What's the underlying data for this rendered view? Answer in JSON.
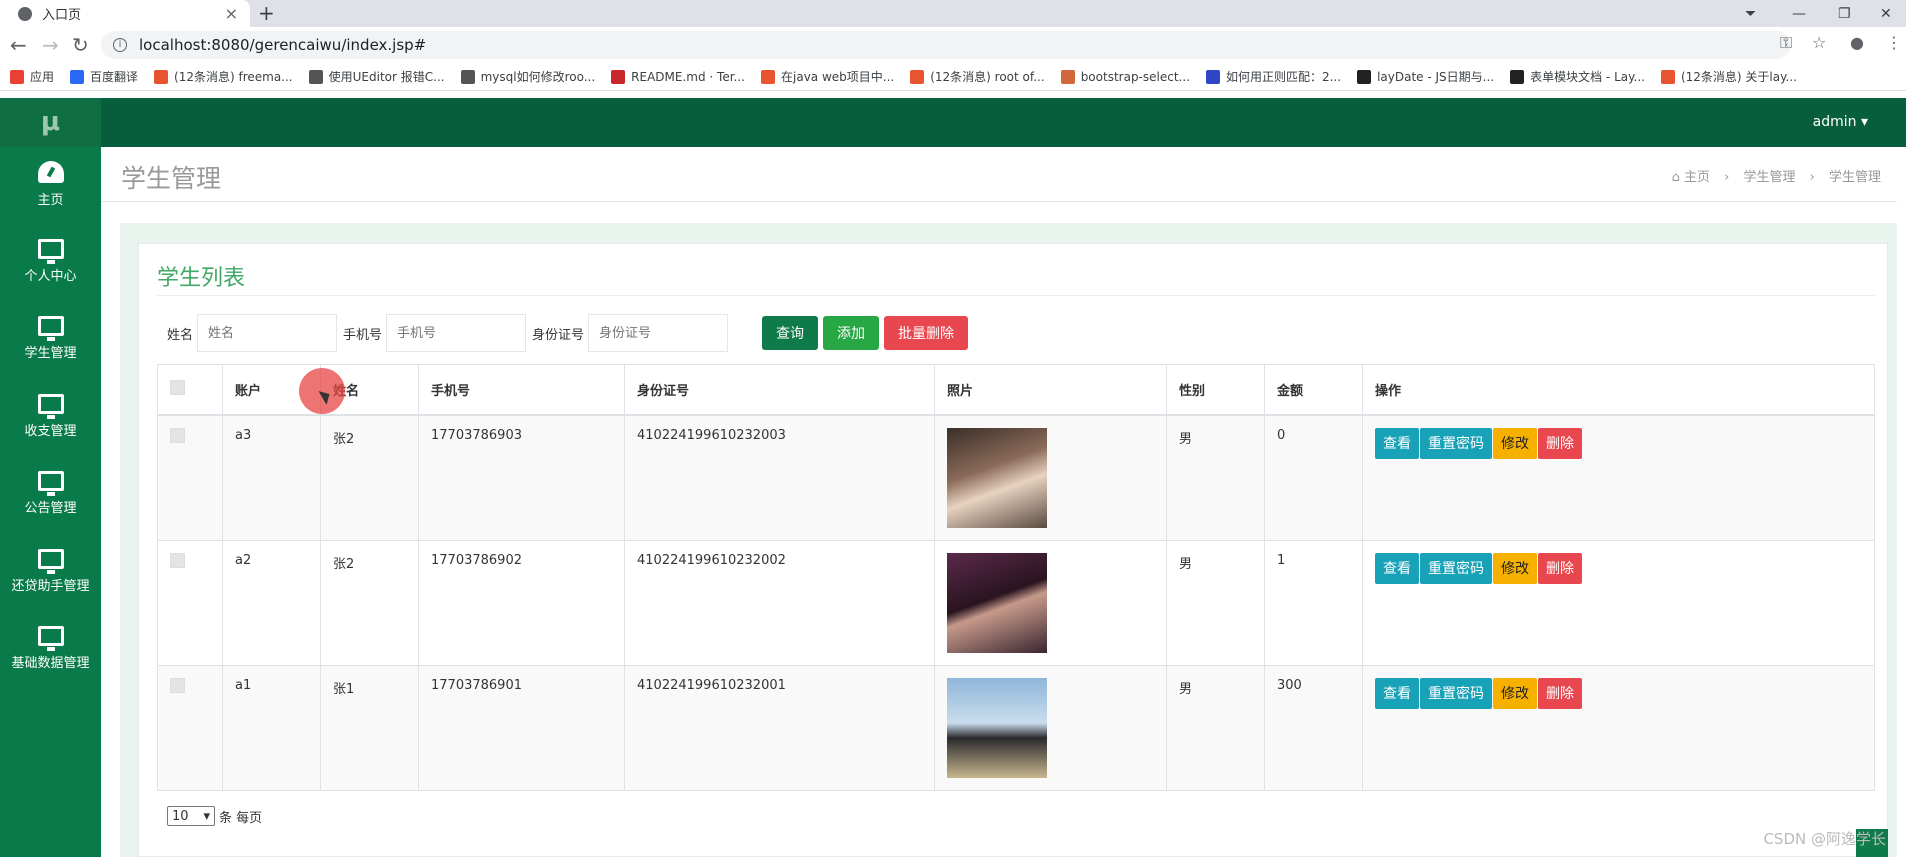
{
  "browser": {
    "tab_title": "入口页",
    "url": "localhost:8080/gerencaiwu/index.jsp#",
    "bookmarks": [
      {
        "label": "应用",
        "color": "#e94235"
      },
      {
        "label": "百度翻译",
        "color": "#2b68f5"
      },
      {
        "label": "(12条消息) freema...",
        "color": "#e8542f"
      },
      {
        "label": "使用UEditor 报错C...",
        "color": "#555555"
      },
      {
        "label": "mysql如何修改roo...",
        "color": "#555555"
      },
      {
        "label": "README.md · Ter...",
        "color": "#c7262c"
      },
      {
        "label": "在java web项目中...",
        "color": "#e8542f"
      },
      {
        "label": "(12条消息) root of...",
        "color": "#e8542f"
      },
      {
        "label": "bootstrap-select...",
        "color": "#d0673b"
      },
      {
        "label": "如何用正则匹配：2...",
        "color": "#3046c8"
      },
      {
        "label": "layDate - JS日期与...",
        "color": "#222222"
      },
      {
        "label": "表单模块文档 - Lay...",
        "color": "#222222"
      },
      {
        "label": "(12条消息) 关于lay...",
        "color": "#e8542f"
      }
    ]
  },
  "app": {
    "logo": "μ",
    "user": "admin ▾",
    "nav": [
      {
        "label": "主页",
        "icon": "dashboard-icon"
      },
      {
        "label": "个人中心",
        "icon": "monitor-icon"
      },
      {
        "label": "学生管理",
        "icon": "monitor-icon"
      },
      {
        "label": "收支管理",
        "icon": "monitor-icon"
      },
      {
        "label": "公告管理",
        "icon": "monitor-icon"
      },
      {
        "label": "还贷助手管理",
        "icon": "monitor-icon"
      },
      {
        "label": "基础数据管理",
        "icon": "monitor-icon"
      }
    ],
    "page_title": "学生管理",
    "breadcrumb": [
      "主页",
      "学生管理",
      "学生管理"
    ]
  },
  "panel": {
    "title": "学生列表",
    "search": {
      "name_label": "姓名",
      "name_placeholder": "姓名",
      "phone_label": "手机号",
      "phone_placeholder": "手机号",
      "id_label": "身份证号",
      "id_placeholder": "身份证号"
    },
    "buttons": {
      "query": "查询",
      "add": "添加",
      "batch_delete": "批量删除"
    },
    "columns": [
      "账户",
      "姓名",
      "手机号",
      "身份证号",
      "照片",
      "性别",
      "金额",
      "操作"
    ],
    "rows": [
      {
        "account": "a3",
        "name": "张2",
        "phone": "17703786903",
        "idcard": "410224199610232003",
        "gender": "男",
        "amount": "0"
      },
      {
        "account": "a2",
        "name": "张2",
        "phone": "17703786902",
        "idcard": "410224199610232002",
        "gender": "男",
        "amount": "1"
      },
      {
        "account": "a1",
        "name": "张1",
        "phone": "17703786901",
        "idcard": "410224199610232001",
        "gender": "男",
        "amount": "300"
      }
    ],
    "ops": {
      "view": "查看",
      "reset": "重置密码",
      "edit": "修改",
      "delete": "删除"
    },
    "pager": {
      "page_size": "10",
      "suffix": "条 每页"
    }
  },
  "watermark": "CSDN @阿逸学长"
}
